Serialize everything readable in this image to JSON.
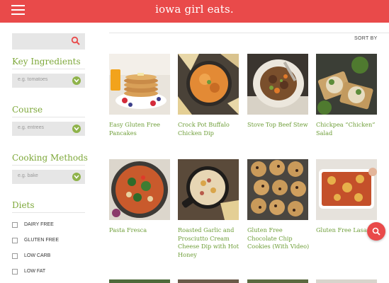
{
  "header": {
    "brand": "iowa girl eats."
  },
  "sidebar": {
    "key_ingredients": {
      "title": "Key Ingredients",
      "placeholder": "e.g. tomatoes"
    },
    "course": {
      "title": "Course",
      "placeholder": "e.g. entrees"
    },
    "cooking_methods": {
      "title": "Cooking Methods",
      "placeholder": "e.g. bake"
    },
    "diets": {
      "title": "Diets",
      "items": [
        "DAIRY FREE",
        "GLUTEN FREE",
        "LOW CARB",
        "LOW FAT"
      ]
    }
  },
  "main": {
    "sort_label": "SORT BY",
    "recipes": [
      {
        "title": "Easy Gluten Free Pancakes"
      },
      {
        "title": "Crock Pot Buffalo Chicken Dip"
      },
      {
        "title": "Stove Top Beef Stew"
      },
      {
        "title": "Chickpea “Chicken” Salad"
      },
      {
        "title": "Pasta Fresca"
      },
      {
        "title": "Roasted Garlic and Prosciutto Cream Cheese Dip with Hot Honey"
      },
      {
        "title": "Gluten Free Chocolate Chip Cookies (With Video)"
      },
      {
        "title": "Gluten Free Lasagna"
      }
    ]
  },
  "colors": {
    "brand_red": "#e94a4a",
    "accent_green": "#7ea83a"
  },
  "icons": {
    "menu": "hamburger-icon",
    "search": "search-icon",
    "select": "chevron-down-icon"
  }
}
